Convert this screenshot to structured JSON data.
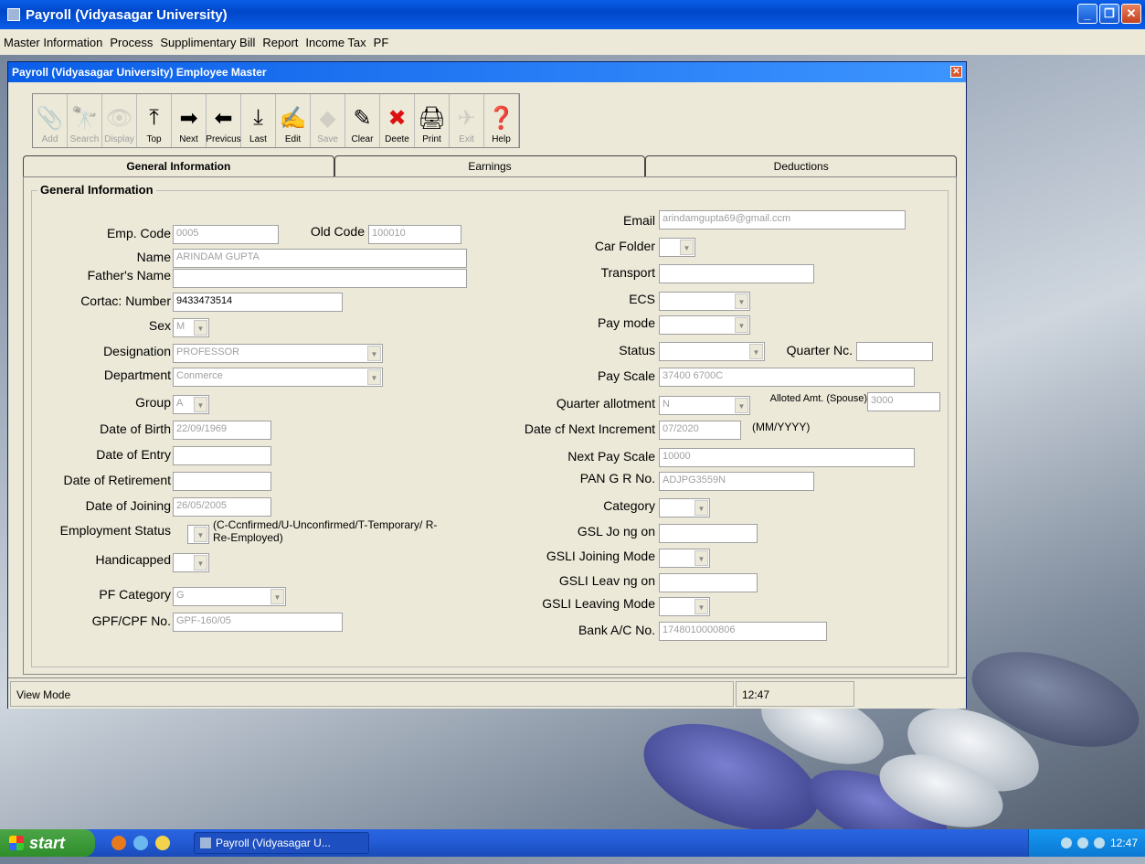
{
  "window": {
    "title": "Payroll (Vidyasagar University)"
  },
  "menu": [
    "Master Information",
    "Process",
    "Supplimentary Bill",
    "Report",
    "Income Tax",
    "PF"
  ],
  "child_window": {
    "title": "Payroll (Vidyasagar University)   Employee Master"
  },
  "toolbar": {
    "buttons": [
      {
        "label": "Add",
        "icon": "paperclip-icon",
        "enabled": false
      },
      {
        "label": "Search",
        "icon": "binoculars-icon",
        "enabled": false
      },
      {
        "label": "Display",
        "icon": "eye-icon",
        "enabled": false
      },
      {
        "label": "Top",
        "icon": "top-icon",
        "enabled": true
      },
      {
        "label": "Next",
        "icon": "arrow-right-icon",
        "enabled": true
      },
      {
        "label": "Previcus",
        "icon": "arrow-left-icon",
        "enabled": true
      },
      {
        "label": "Last",
        "icon": "last-icon",
        "enabled": true
      },
      {
        "label": "Edit",
        "icon": "edit-icon",
        "enabled": true
      },
      {
        "label": "Save",
        "icon": "save-icon",
        "enabled": false
      },
      {
        "label": "Clear",
        "icon": "eraser-icon",
        "enabled": true
      },
      {
        "label": "Deete",
        "icon": "delete-icon",
        "enabled": true
      },
      {
        "label": "Print",
        "icon": "print-icon",
        "enabled": true
      },
      {
        "label": "Exit",
        "icon": "exit-icon",
        "enabled": false
      },
      {
        "label": "Help",
        "icon": "help-icon",
        "enabled": true
      }
    ]
  },
  "tabs": [
    "General Information",
    "Earnings",
    "Deductions"
  ],
  "form": {
    "legend": "General Information",
    "left": {
      "emp_code": {
        "label": "Emp. Code",
        "value": "0005"
      },
      "old_code": {
        "label": "Old Code",
        "value": "100010"
      },
      "name": {
        "label": "Name",
        "value": "ARINDAM GUPTA"
      },
      "father": {
        "label": "Father's Name",
        "value": ""
      },
      "contact": {
        "label": "Cortac: Number",
        "value": "9433473514"
      },
      "sex": {
        "label": "Sex",
        "value": "M"
      },
      "designation": {
        "label": "Designation",
        "value": "PROFESSOR"
      },
      "department": {
        "label": "Department",
        "value": "Conmerce"
      },
      "group": {
        "label": "Group",
        "value": "A"
      },
      "dob": {
        "label": "Date of Birth",
        "value": "22/09/1969"
      },
      "doe": {
        "label": "Date of Entry",
        "value": ""
      },
      "dor": {
        "label": "Date of Retirement",
        "value": ""
      },
      "doj": {
        "label": "Date of Joining",
        "value": "26/05/2005"
      },
      "emp_status": {
        "label": "Employment Status",
        "value": "",
        "note": "(C-Ccnfirmed/U-Unconfirmed/T-Temporary/ R-Re-Employed)"
      },
      "handicapped": {
        "label": "Handicapped",
        "value": ""
      },
      "pf_category": {
        "label": "PF Category",
        "value": "G"
      },
      "gpf_no": {
        "label": "GPF/CPF No.",
        "value": "GPF-160/05"
      }
    },
    "right": {
      "email": {
        "label": "Email",
        "value": "arindamgupta69@gmail.ccm"
      },
      "car_holder": {
        "label": "Car Folder",
        "value": ""
      },
      "transport": {
        "label": "Transport",
        "value": ""
      },
      "ecs": {
        "label": "ECS",
        "value": ""
      },
      "pay_mode": {
        "label": "Pay mode",
        "value": ""
      },
      "status": {
        "label": "Status",
        "value": ""
      },
      "quarter_no": {
        "label": "Quarter Nc.",
        "value": ""
      },
      "pay_scale": {
        "label": "Pay Scale",
        "value": "37400 6700C"
      },
      "quarter_allot": {
        "label": "Quarter allotment",
        "value": "N"
      },
      "alloted_amt": {
        "label": "Alloted Amt. (Spouse)",
        "value": "3000"
      },
      "next_incr": {
        "label": "Date cf Next Increment",
        "value": "07/2020",
        "hint": "(MM/YYYY)"
      },
      "next_pay_scale": {
        "label": "Next Pay Scale",
        "value": "10000"
      },
      "pan": {
        "label": "PAN G R No.",
        "value": "ADJPG3559N"
      },
      "category": {
        "label": "Category",
        "value": ""
      },
      "gsl_joining": {
        "label": "GSL Jo ng on",
        "value": ""
      },
      "gsli_join_mode": {
        "label": "GSLI Joining Mode",
        "value": ""
      },
      "gsli_leaving": {
        "label": "GSLI Leav ng on",
        "value": ""
      },
      "gsli_leave_mode": {
        "label": "GSLI Leaving Mode",
        "value": ""
      },
      "bank": {
        "label": "Bank A/C No.",
        "value": "1748010000806"
      }
    }
  },
  "statusbar": {
    "mode": "View Mode",
    "time": "12:47"
  },
  "taskbar": {
    "start": "start",
    "task": "Payroll (Vidyasagar U...",
    "clock": "12:47"
  }
}
